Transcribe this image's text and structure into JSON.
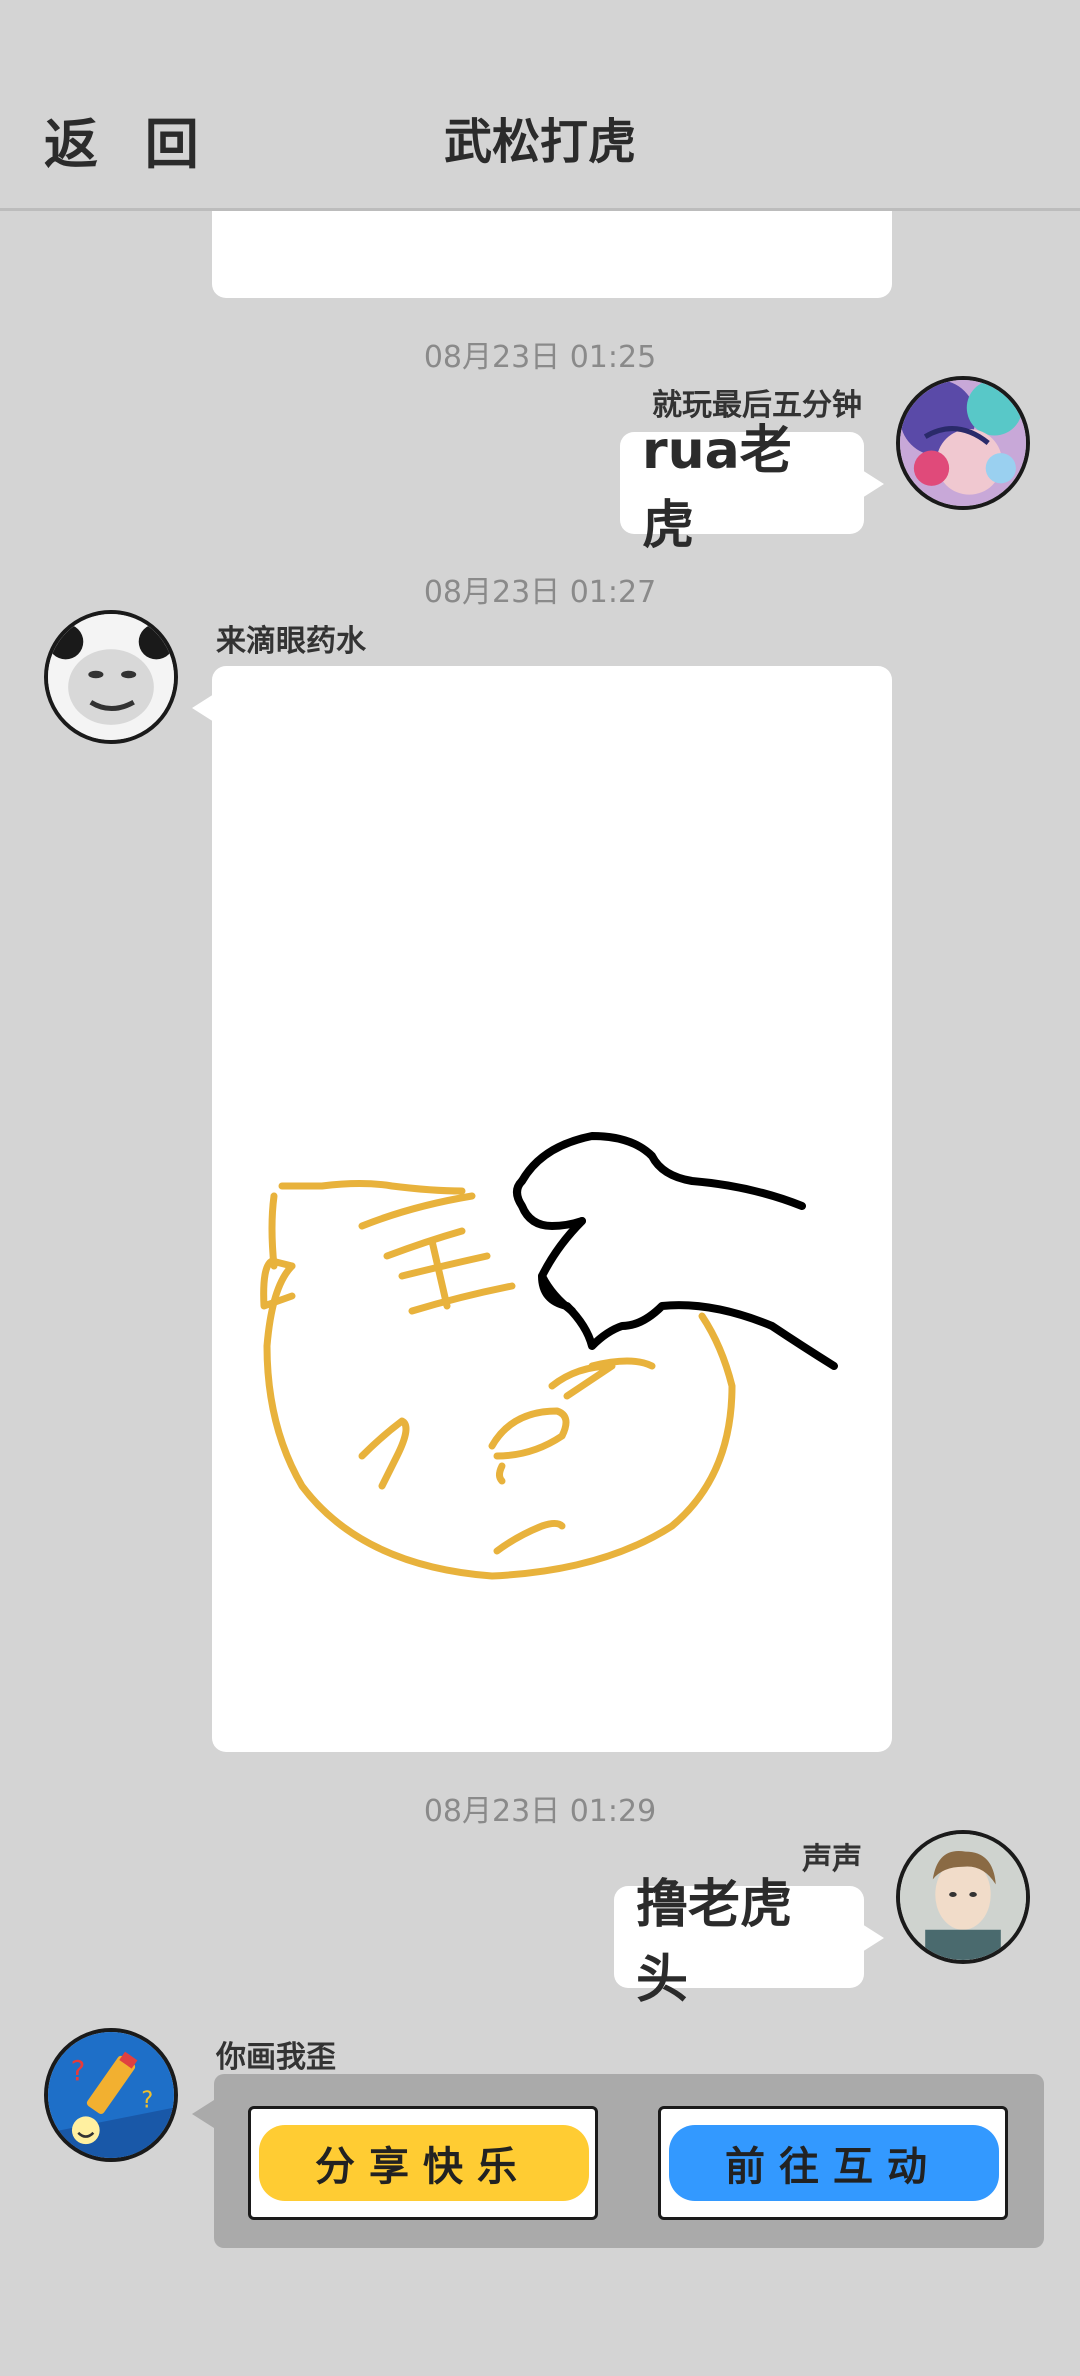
{
  "header": {
    "back_label": "返 回",
    "title": "武松打虎"
  },
  "messages": [
    {
      "time": "08月23日  01:25",
      "sender": "就玩最后五分钟",
      "text": "rua老虎",
      "side": "right",
      "avatar": "anime-avatar"
    },
    {
      "time": "08月23日  01:27",
      "sender": "来滴眼药水",
      "side": "left",
      "avatar": "meme-face-avatar",
      "image": "tiger-head-pet-drawing"
    },
    {
      "time": "08月23日  01:29",
      "sender": "声声",
      "text": "撸老虎头",
      "side": "right",
      "avatar": "boy-portrait-avatar"
    }
  ],
  "game": {
    "sender": "你画我歪",
    "avatar": "drawing-game-avatar",
    "share_label": "分享快乐",
    "interact_label": "前往互动",
    "share_color": "#ffcc33",
    "interact_color": "#3399ff"
  },
  "colors": {
    "background": "#d4d4d4",
    "tiger_stroke": "#e8b23c",
    "paw_stroke": "#000000"
  }
}
